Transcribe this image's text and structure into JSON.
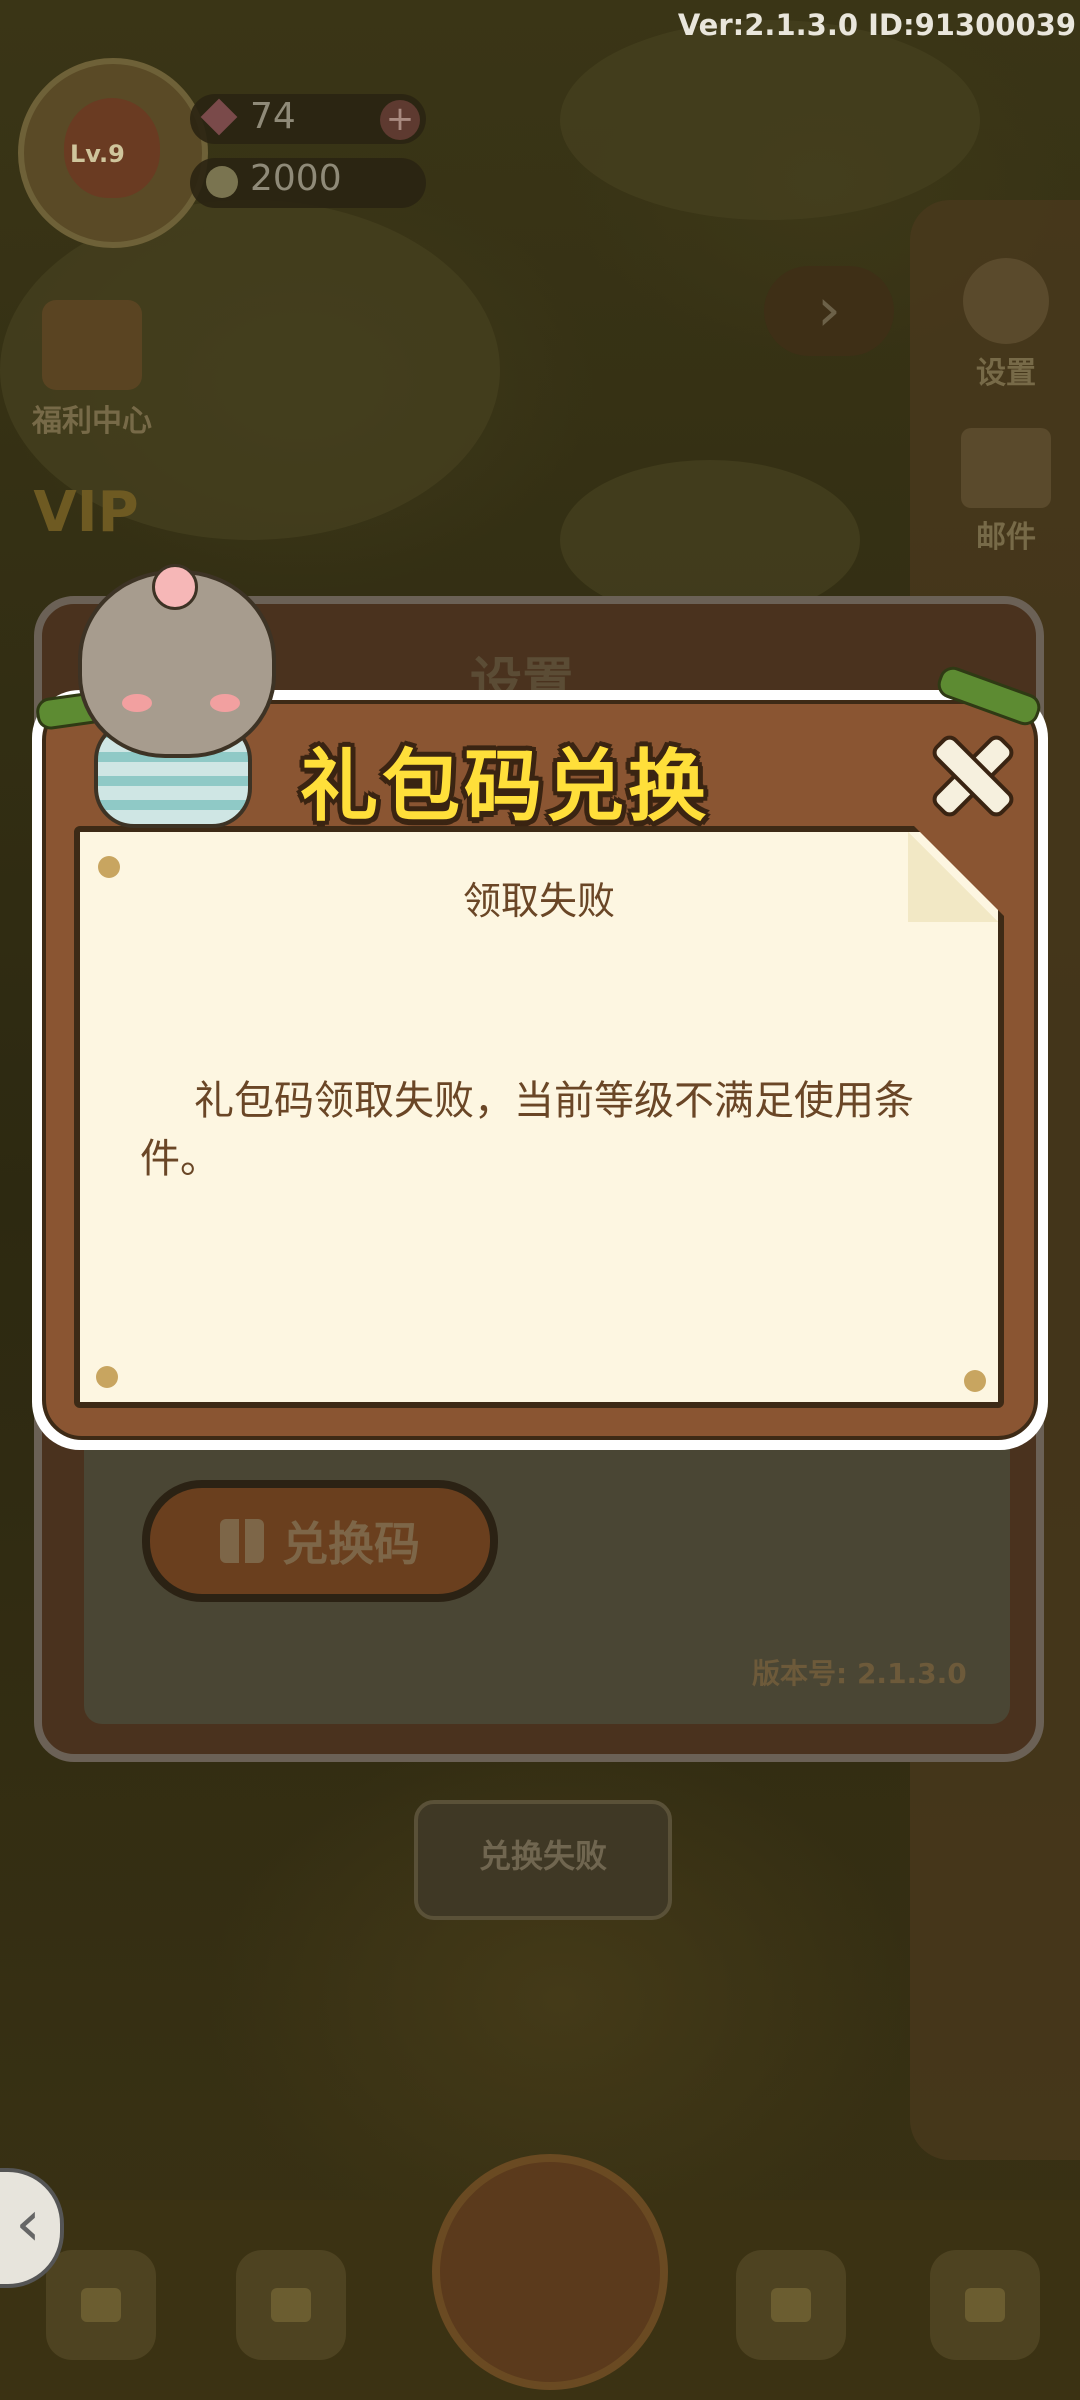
{
  "status_bar": {
    "version_text": "Ver:2.1.3.0 ID:91300039"
  },
  "player": {
    "level": "Lv.9",
    "gems": "74",
    "acorns": "2000"
  },
  "left_menu": {
    "welfare_label": "福利中心",
    "vip_label": "VIP"
  },
  "right_menu": {
    "settings_label": "设置",
    "mail_label": "邮件"
  },
  "settings_panel": {
    "title": "设置",
    "redeem_button": "兑换码",
    "version_label": "版本号: 2.1.3.0"
  },
  "toast": {
    "text": "兑换失败"
  },
  "dialog": {
    "title": "礼包码兑换",
    "subtitle": "领取失败",
    "message": "礼包码领取失败，当前等级不满足使用条件。"
  },
  "colors": {
    "dialog_wood": "#8a5532",
    "paper": "#fdf6e1",
    "title_yellow": "#ffdf3a",
    "text_brown": "#6a4626"
  }
}
